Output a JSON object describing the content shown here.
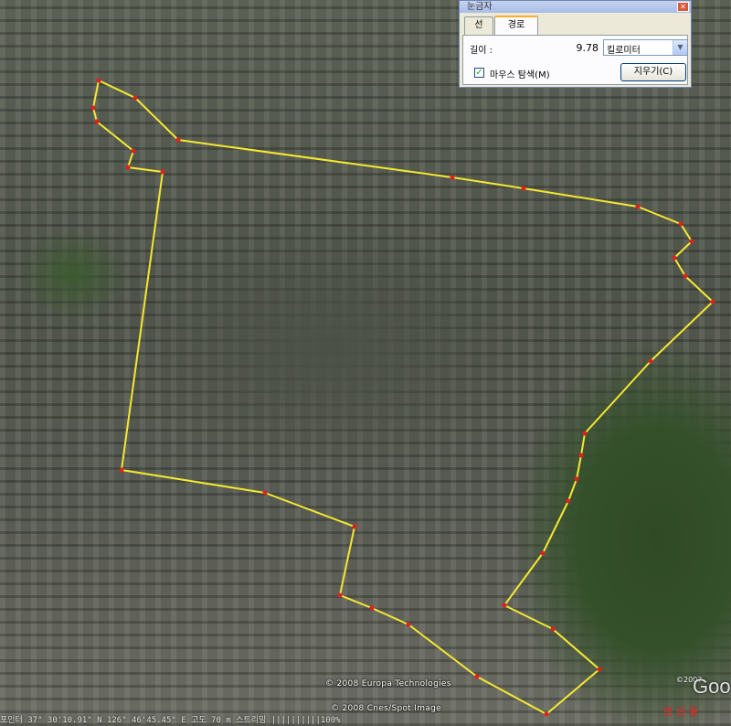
{
  "map": {
    "copyright_1": "© 2008 Europa Technologies",
    "copyright_2": "© 2008 Cnes/Spot Image",
    "status_bar": "포인터  37° 30'10.91\" N  126° 46'45.45\" E  고도   70 m   스트리밍 ||||||||||100%",
    "logo": "Goo",
    "year": "©2007",
    "stamp": "연 산 용",
    "route_color": "#f5e830",
    "point_color": "#e02020"
  },
  "ruler": {
    "title": "눈금자",
    "tabs": [
      {
        "label": "선",
        "active": false
      },
      {
        "label": "경로",
        "active": true
      }
    ],
    "length_label": "길이 :",
    "length_value": "9.78",
    "unit": "킬로미터",
    "mouse_nav_label": "마우스 탐색(M)",
    "mouse_nav_checked": true,
    "clear_label": "지우기(C)"
  }
}
